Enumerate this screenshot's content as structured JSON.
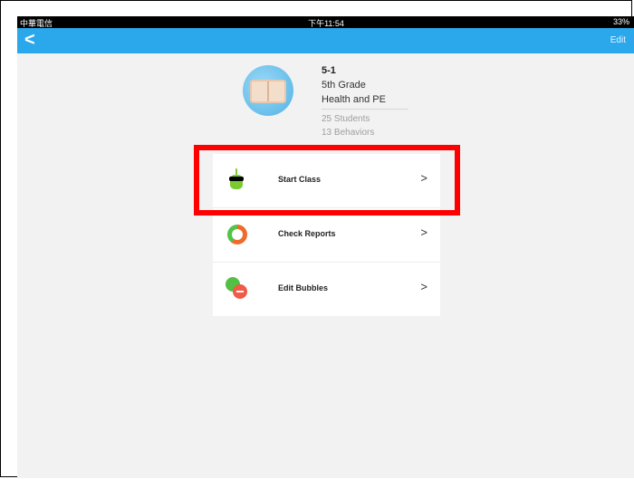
{
  "status": {
    "carrier": "中華電信",
    "time": "下午11:54",
    "battery": "33%"
  },
  "nav": {
    "back_label": "<",
    "edit_label": "Edit"
  },
  "class": {
    "code": "5-1",
    "grade": "5th Grade",
    "subject": "Health and PE",
    "students": "25 Students",
    "behaviors": "13 Behaviors"
  },
  "menu": {
    "items": [
      {
        "label": "Start Class",
        "icon": "monster-icon"
      },
      {
        "label": "Check Reports",
        "icon": "report-donut-icon"
      },
      {
        "label": "Edit Bubbles",
        "icon": "bubble-minus-icon"
      }
    ],
    "chevron": ">"
  },
  "annotation": {
    "highlight_color": "#ff0000"
  }
}
